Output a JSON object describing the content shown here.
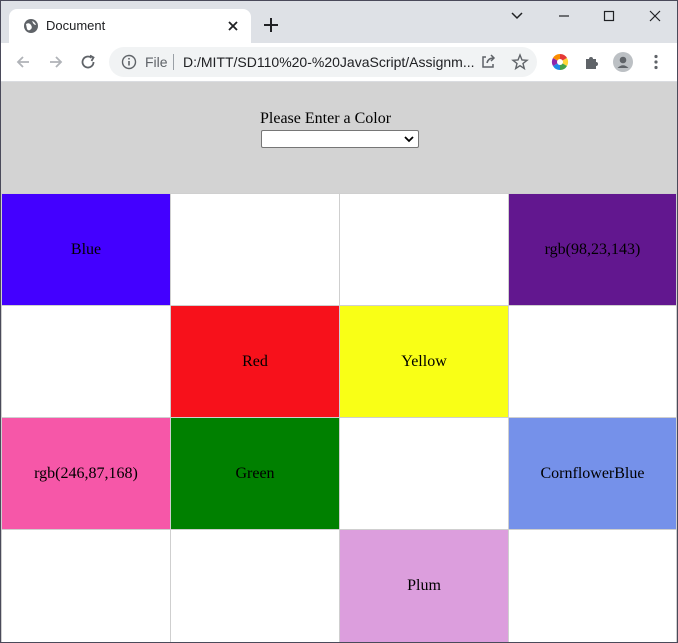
{
  "browser": {
    "tab_title": "Document",
    "omnibox": {
      "scheme_label": "File",
      "url": "D:/MITT/SD110%20-%20JavaScript/Assignm..."
    }
  },
  "page": {
    "prompt": "Please Enter a Color",
    "select_value": "",
    "grid": [
      {
        "label": "Blue",
        "color": "#4300ff"
      },
      {
        "label": "",
        "color": "#ffffff"
      },
      {
        "label": "",
        "color": "#ffffff"
      },
      {
        "label": "rgb(98,23,143)",
        "color": "#62178f"
      },
      {
        "label": "",
        "color": "#ffffff"
      },
      {
        "label": "Red",
        "color": "#f7111b"
      },
      {
        "label": "Yellow",
        "color": "#f9ff16"
      },
      {
        "label": "",
        "color": "#ffffff"
      },
      {
        "label": "rgb(246,87,168)",
        "color": "#f657a8"
      },
      {
        "label": "Green",
        "color": "#008000"
      },
      {
        "label": "",
        "color": "#ffffff"
      },
      {
        "label": "CornflowerBlue",
        "color": "#7591ea"
      },
      {
        "label": "",
        "color": "#ffffff"
      },
      {
        "label": "",
        "color": "#ffffff"
      },
      {
        "label": "Plum",
        "color": "#dc9edd"
      },
      {
        "label": "",
        "color": "#ffffff"
      }
    ]
  },
  "colors": {
    "header_bg": "#d3d3d3",
    "tabstrip_bg": "#dee1e6"
  }
}
